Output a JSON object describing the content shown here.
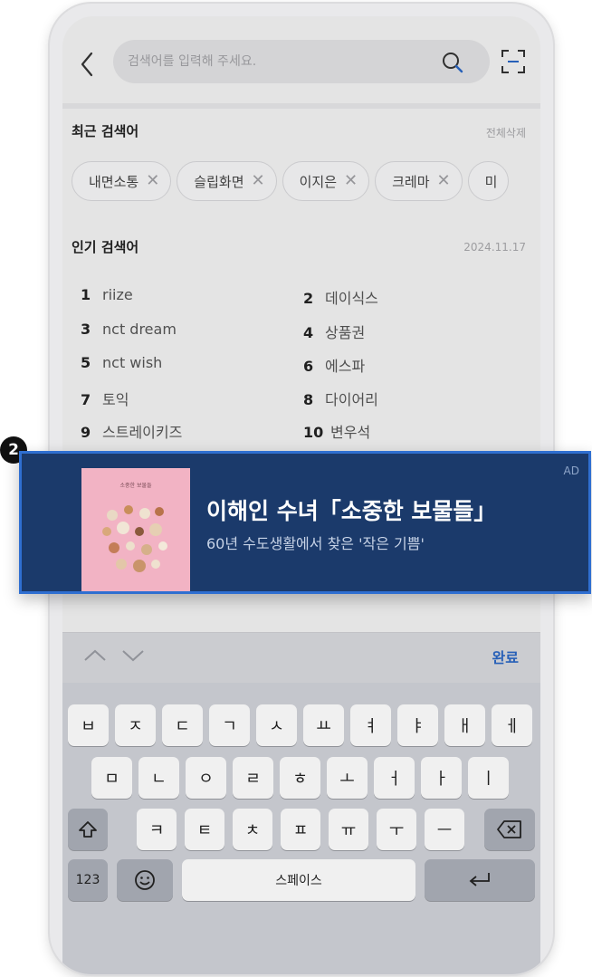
{
  "search": {
    "placeholder": "검색어를 입력해 주세요."
  },
  "recent": {
    "title": "최근 검색어",
    "clear_all": "전체삭제",
    "chips": [
      "내면소통",
      "슬립화면",
      "이지은",
      "크레마",
      "미"
    ]
  },
  "popular": {
    "title": "인기 검색어",
    "date": "2024.11.17",
    "items": [
      {
        "rank": "1",
        "term": "riize"
      },
      {
        "rank": "2",
        "term": "데이식스"
      },
      {
        "rank": "3",
        "term": "nct dream"
      },
      {
        "rank": "4",
        "term": "상품권"
      },
      {
        "rank": "5",
        "term": "nct wish"
      },
      {
        "rank": "6",
        "term": "에스파"
      },
      {
        "rank": "7",
        "term": "토익"
      },
      {
        "rank": "8",
        "term": "다이어리"
      },
      {
        "rank": "9",
        "term": "스트레이키즈"
      },
      {
        "rank": "10",
        "term": "변우석"
      }
    ]
  },
  "ad": {
    "badge": "2",
    "label": "AD",
    "title": "이해인 수녀「소중한 보물들」",
    "subtitle": "60년 수도생활에서 찾은 '작은 기쁨'",
    "book_title": "소중한 보물들"
  },
  "keyboard": {
    "done": "완료",
    "row1": [
      "ㅂ",
      "ㅈ",
      "ㄷ",
      "ㄱ",
      "ㅅ",
      "ㅛ",
      "ㅕ",
      "ㅑ",
      "ㅐ",
      "ㅔ"
    ],
    "row2": [
      "ㅁ",
      "ㄴ",
      "ㅇ",
      "ㄹ",
      "ㅎ",
      "ㅗ",
      "ㅓ",
      "ㅏ",
      "ㅣ"
    ],
    "row3": [
      "ㅋ",
      "ㅌ",
      "ㅊ",
      "ㅍ",
      "ㅠ",
      "ㅜ",
      "ㅡ"
    ],
    "numbers": "123",
    "space": "스페이스"
  },
  "colors": {
    "ad_bg": "#1b3a6b",
    "ad_border": "#2f6fd1",
    "accent": "#2a66c4"
  }
}
